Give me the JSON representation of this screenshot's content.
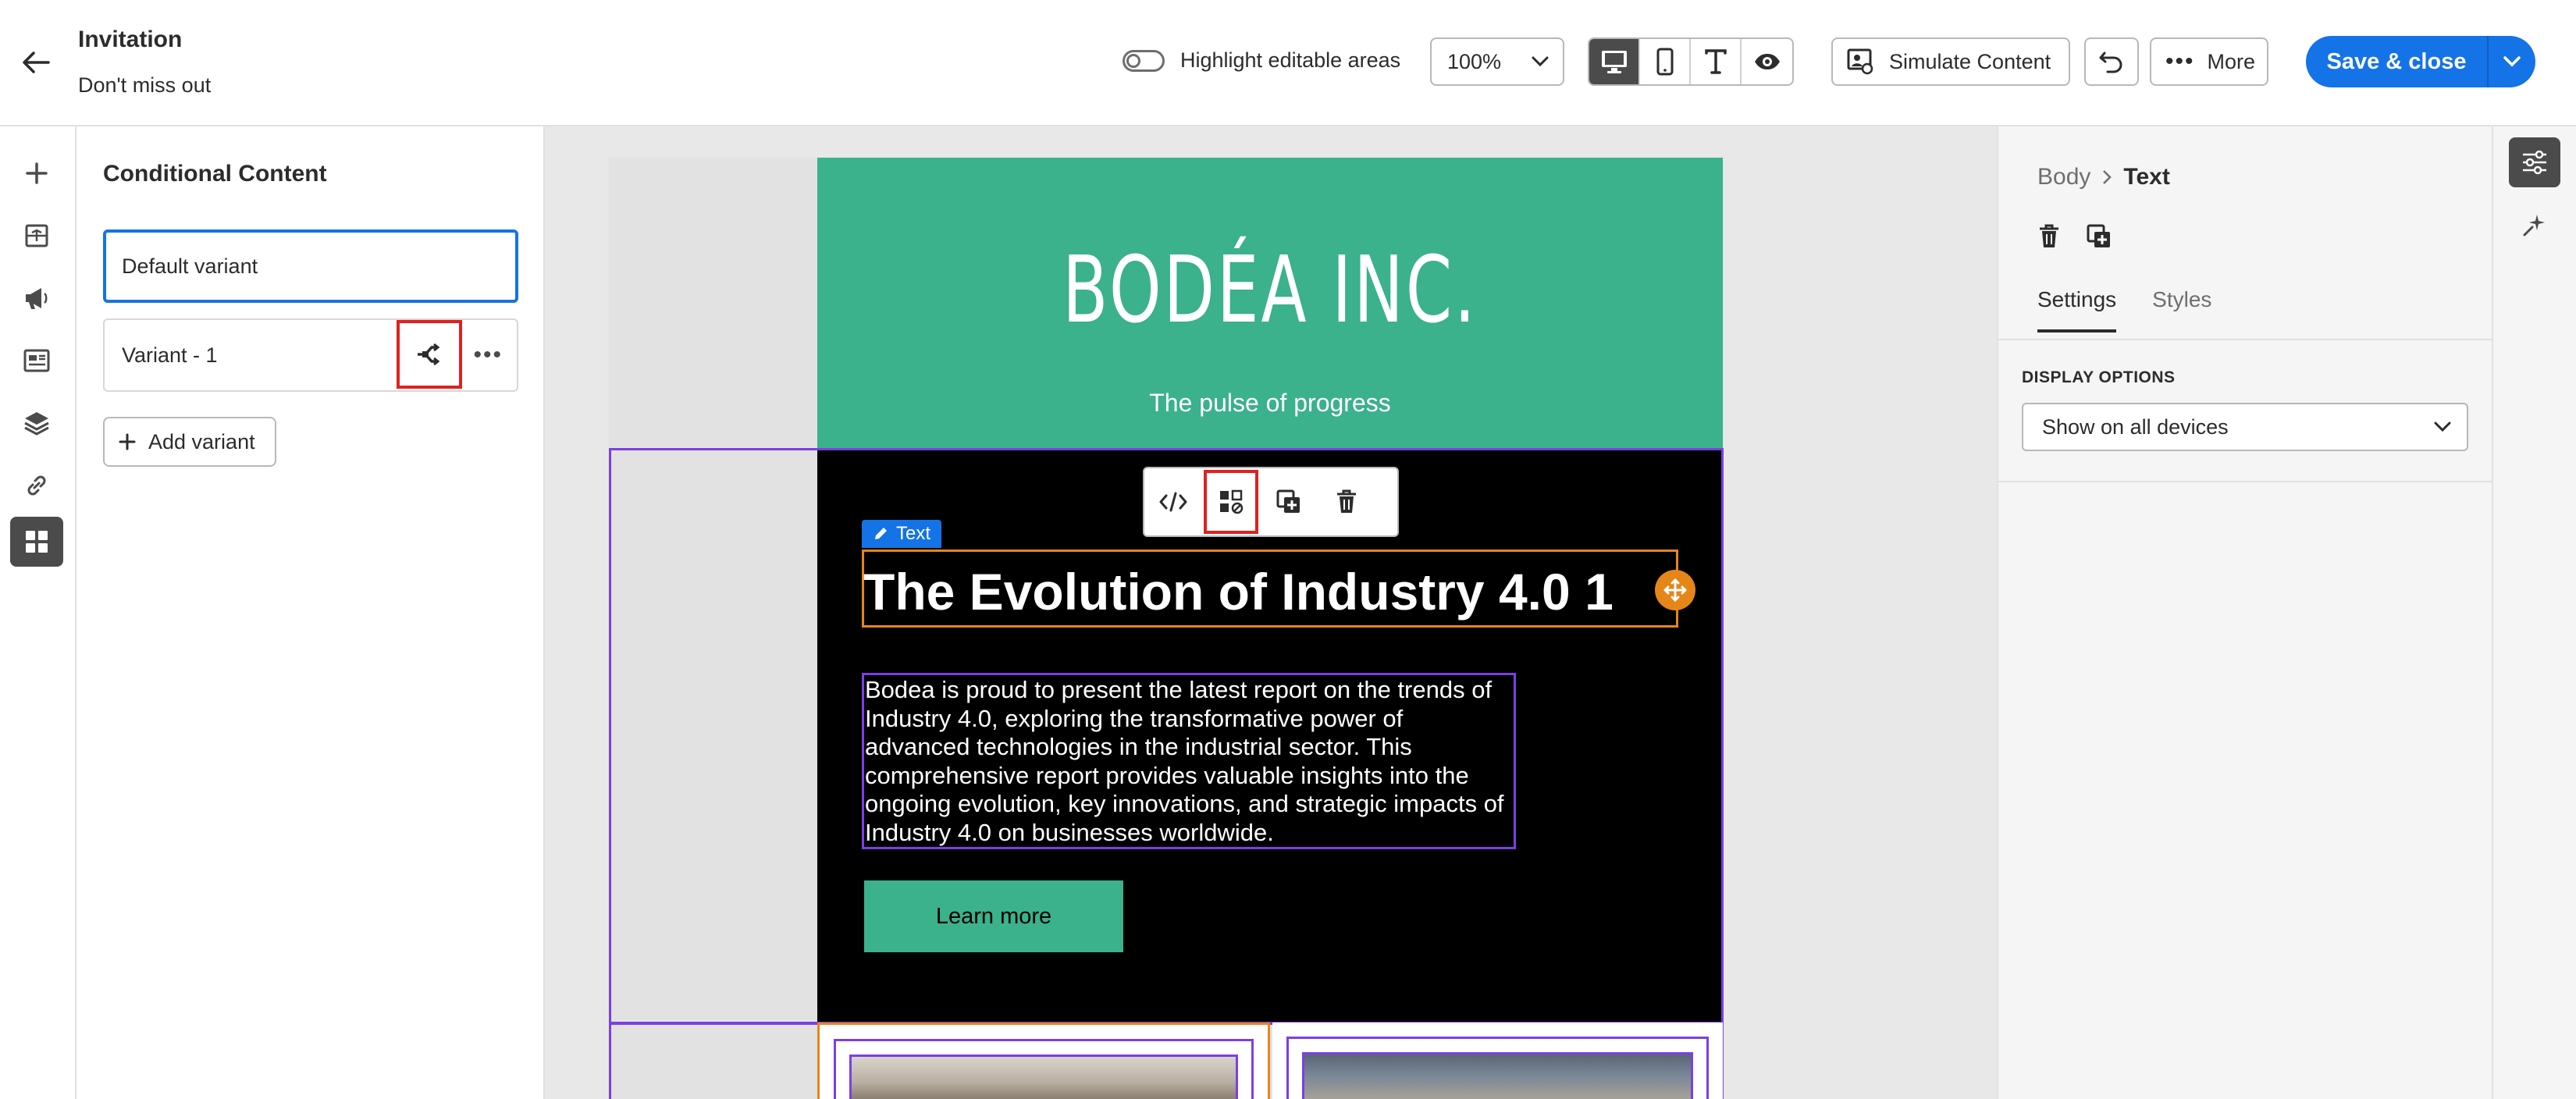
{
  "header": {
    "title": "Invitation",
    "subtitle": "Don't miss out",
    "highlight_label": "Highlight editable areas",
    "zoom": "100%",
    "simulate_label": "Simulate Content",
    "more_label": "More",
    "save_label": "Save & close"
  },
  "left_panel": {
    "title": "Conditional Content",
    "variants": [
      {
        "label": "Default variant"
      },
      {
        "label": "Variant - 1"
      }
    ],
    "add_variant_label": "Add variant"
  },
  "email": {
    "logo": "BODÉA INC.",
    "tagline": "The pulse of progress",
    "text_chip": "Text",
    "heading": "The Evolution of Industry 4.0 1",
    "paragraph": "Bodea is proud to present the latest report on the trends of Industry 4.0, exploring the transformative power of advanced technologies in the industrial sector. This comprehensive report provides valuable insights into the ongoing evolution, key innovations, and strategic impacts of Industry 4.0 on businesses worldwide.",
    "button_label": "Learn more"
  },
  "right_panel": {
    "breadcrumb_parent": "Body",
    "breadcrumb_current": "Text",
    "tabs": [
      {
        "label": "Settings"
      },
      {
        "label": "Styles"
      }
    ],
    "section_title": "DISPLAY OPTIONS",
    "display_option": "Show on all devices"
  },
  "colors": {
    "accent": "#1473e6",
    "brand_green": "#3bb18c",
    "highlight_red": "#e02020",
    "selection_orange": "#e68619",
    "selection_purple": "#7c3fe4"
  }
}
